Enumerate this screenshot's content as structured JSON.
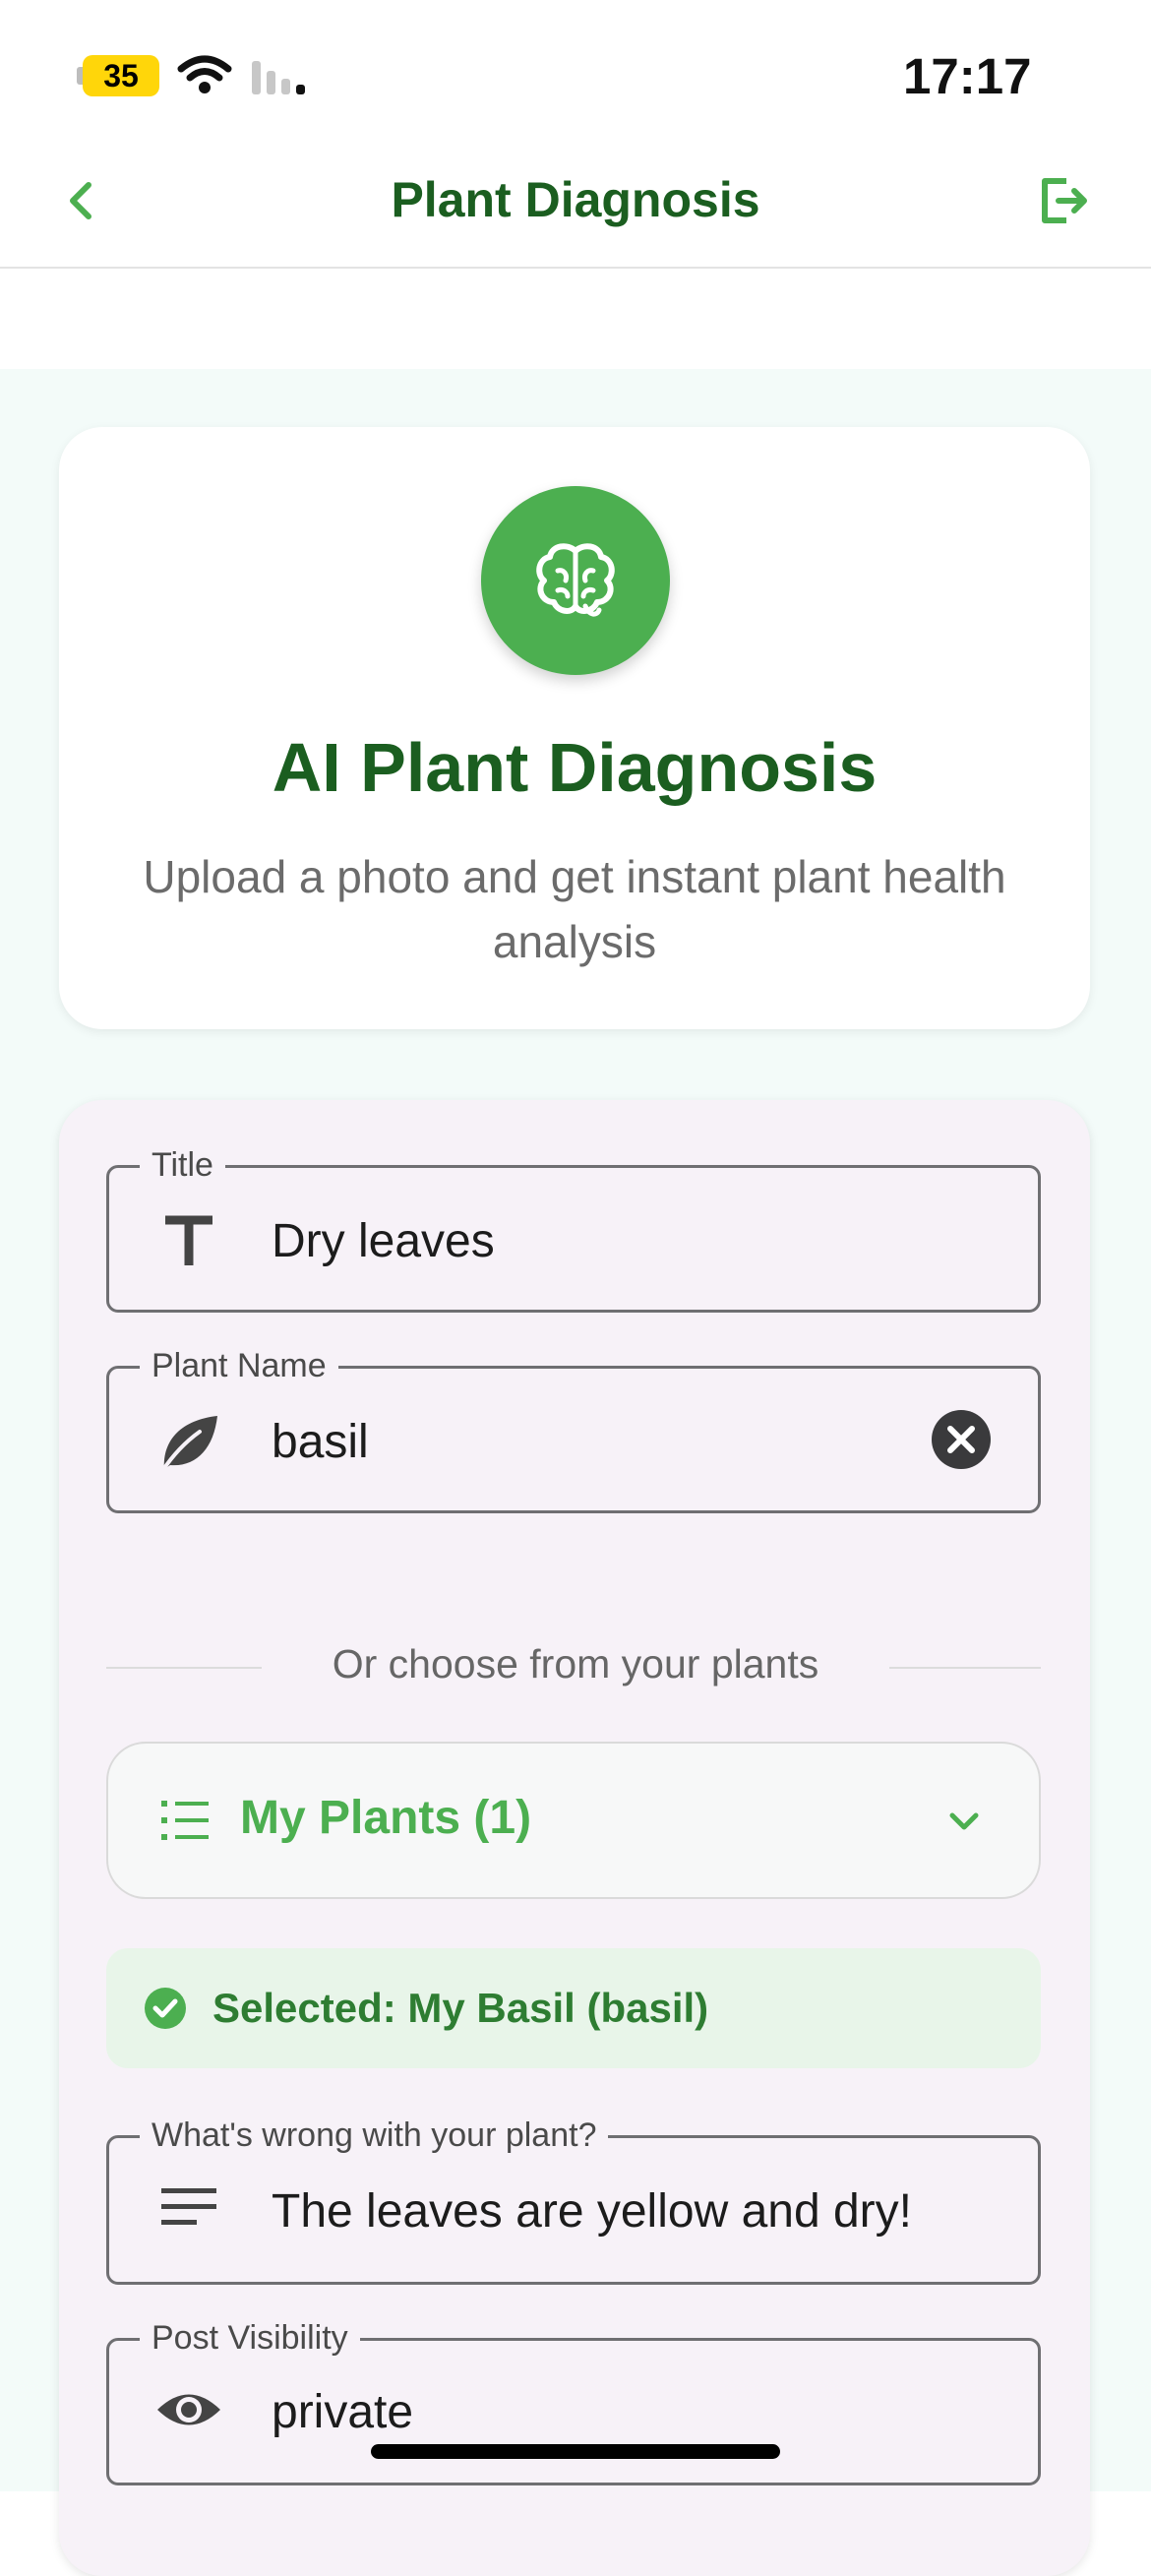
{
  "status_bar": {
    "time": "17:17",
    "battery": "35"
  },
  "header": {
    "title": "Plant Diagnosis"
  },
  "hero": {
    "title": "AI Plant Diagnosis",
    "subtitle": "Upload a photo and get instant plant health analysis"
  },
  "form": {
    "title_field": {
      "label": "Title",
      "value": "Dry leaves"
    },
    "plant_name_field": {
      "label": "Plant Name",
      "value": "basil"
    },
    "divider_text": "Or choose from your plants",
    "my_plants": {
      "label": "My Plants (1)"
    },
    "selected": {
      "text": "Selected: My Basil (basil)"
    },
    "problem_field": {
      "label": "What's wrong with your plant?",
      "value": "The leaves are yellow and dry!"
    },
    "visibility_field": {
      "label": "Post Visibility",
      "value": "private"
    }
  },
  "colors": {
    "primary_green": "#4caf50",
    "dark_green": "#1b5e20",
    "page_background": "#f3fbf9",
    "form_background": "#f7f2f8"
  },
  "icons": [
    "back-chevron-icon",
    "logout-icon",
    "brain-icon",
    "text-format-icon",
    "leaf-icon",
    "clear-icon",
    "list-icon",
    "chevron-down-icon",
    "check-circle-icon",
    "notes-icon",
    "eye-icon",
    "wifi-icon",
    "signal-icon"
  ]
}
